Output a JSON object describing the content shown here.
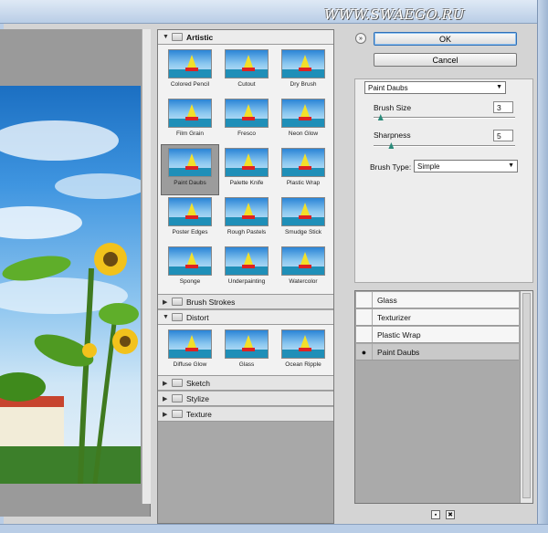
{
  "watermark": "WWW.SWAEGO.RU",
  "buttons": {
    "ok": "OK",
    "cancel": "Cancel",
    "collapse": "»"
  },
  "categories": {
    "artistic": {
      "label": "Artistic",
      "filters": [
        "Colored Pencil",
        "Cutout",
        "Dry Brush",
        "Film Grain",
        "Fresco",
        "Neon Glow",
        "Paint Daubs",
        "Palette Knife",
        "Plastic Wrap",
        "Poster Edges",
        "Rough Pastels",
        "Smudge Stick",
        "Sponge",
        "Underpainting",
        "Watercolor"
      ],
      "selected": "Paint Daubs"
    },
    "brush_strokes": {
      "label": "Brush Strokes"
    },
    "distort": {
      "label": "Distort",
      "filters": [
        "Diffuse Glow",
        "Glass",
        "Ocean Ripple"
      ]
    },
    "sketch": {
      "label": "Sketch"
    },
    "stylize": {
      "label": "Stylize"
    },
    "texture": {
      "label": "Texture"
    }
  },
  "settings": {
    "filter_select": "Paint Daubs",
    "brush_size_label": "Brush Size",
    "brush_size_value": "3",
    "brush_size_fraction": 0.05,
    "sharpness_label": "Sharpness",
    "sharpness_value": "5",
    "sharpness_fraction": 0.125,
    "brush_type_label": "Brush Type:",
    "brush_type_value": "Simple"
  },
  "layers": [
    {
      "name": "Glass",
      "visible": false,
      "active": false
    },
    {
      "name": "Texturizer",
      "visible": false,
      "active": false
    },
    {
      "name": "Plastic Wrap",
      "visible": false,
      "active": false
    },
    {
      "name": "Paint Daubs",
      "visible": true,
      "active": true
    }
  ],
  "icons": {
    "eye": "eye-icon",
    "new_layer": "new-layer-icon",
    "delete_layer": "trash-icon"
  }
}
